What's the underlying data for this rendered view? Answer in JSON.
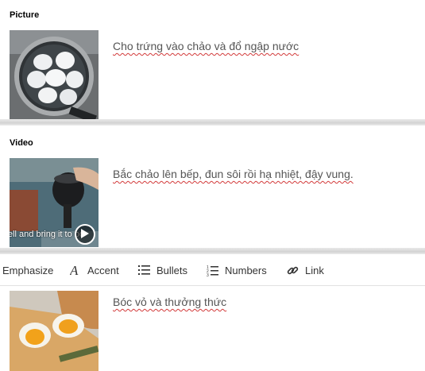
{
  "picture_block": {
    "title": "Picture",
    "caption": "Cho trứng vào chảo và đổ ngập nước"
  },
  "video_block": {
    "title": "Video",
    "caption": "Bắc chảo lên bếp, đun sôi rồi hạ nhiệt, đậy vung.",
    "overlay_text": "ell and bring it to bo",
    "play_icon": "play-icon"
  },
  "toolbar": {
    "emphasize": "Emphasize",
    "accent": "Accent",
    "accent_icon": "italic-a-icon",
    "bullets": "Bullets",
    "bullets_icon": "bullets-icon",
    "numbers": "Numbers",
    "numbers_icon": "numbered-list-icon",
    "link": "Link",
    "link_icon": "link-icon"
  },
  "third_block": {
    "caption": "Bóc vỏ và thưởng thức"
  },
  "colors": {
    "spellcheck_underline": "#d23a3a",
    "divider": "#d3d3d3"
  }
}
